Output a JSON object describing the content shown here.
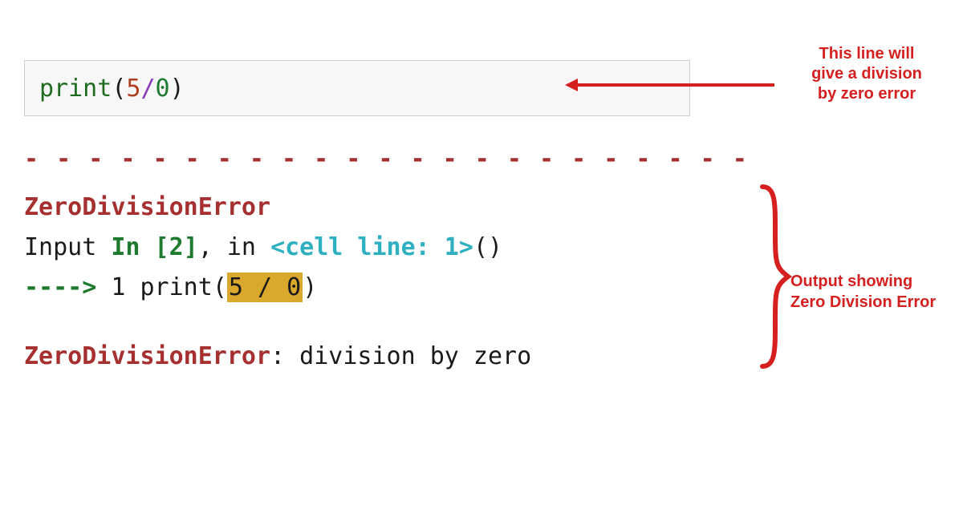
{
  "code_cell": {
    "func": "print",
    "open": "(",
    "num1": "5",
    "sp1": " ",
    "op": "/",
    "sp2": " ",
    "num2": "0",
    "close": ")"
  },
  "annotation_top": {
    "line1": "This line will",
    "line2": "give a division",
    "line3": "by zero error"
  },
  "separator": "- - - - - - - - - - - - - - - - - - - - - - - - - - - - - - - - - - - - - - - - - - - -",
  "traceback": {
    "error_name": "ZeroDivisionError",
    "input_prefix": "Input ",
    "in_label": "In [",
    "in_num": "2",
    "in_close": "]",
    "comma_in": ", in ",
    "cell_line": "<cell line: 1>",
    "parens": "()",
    "arrow": "----> ",
    "line_num": "1",
    "sp": " ",
    "func": "print",
    "open": "(",
    "hl": "5 / 0",
    "close": ")",
    "final_err": "ZeroDivisionError",
    "final_msg": ": division by zero"
  },
  "annotation_bottom": {
    "line1": "Output showing",
    "line2": "Zero Division Error"
  }
}
